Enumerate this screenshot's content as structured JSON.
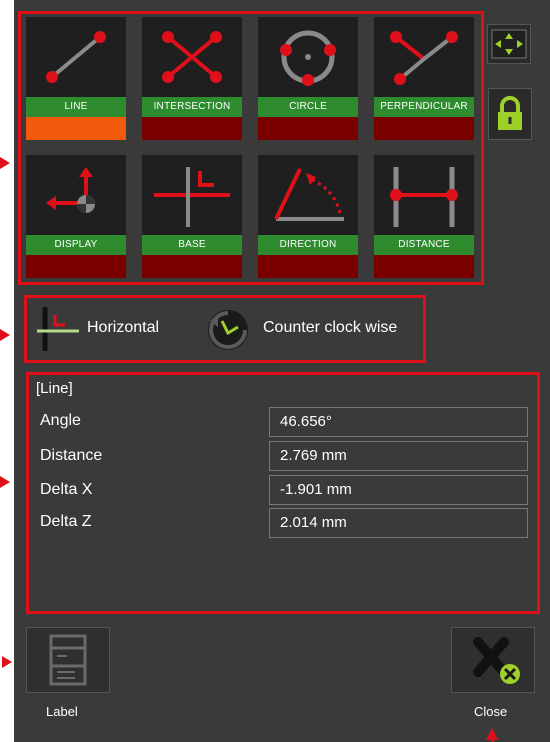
{
  "tools": [
    {
      "label": "LINE",
      "active": true
    },
    {
      "label": "INTERSECTION",
      "active": false
    },
    {
      "label": "CIRCLE",
      "active": false
    },
    {
      "label": "PERPENDICULAR",
      "active": false
    },
    {
      "label": "DISPLAY",
      "active": false
    },
    {
      "label": "BASE",
      "active": false
    },
    {
      "label": "DIRECTION",
      "active": false
    },
    {
      "label": "DISTANCE",
      "active": false
    }
  ],
  "sidebar": {
    "move_icon": "arrows-icon",
    "lock_icon": "lock-icon"
  },
  "modes": {
    "base": "Horizontal",
    "direction": "Counter clock wise"
  },
  "info": {
    "title": "[Line]",
    "rows": [
      {
        "label": "Angle",
        "value": "46.656°"
      },
      {
        "label": "Distance",
        "value": "2.769 mm"
      },
      {
        "label": "Delta X",
        "value": "-1.901 mm"
      },
      {
        "label": "Delta Z",
        "value": "2.014 mm"
      }
    ]
  },
  "buttons": {
    "label": "Label",
    "close": "Close"
  },
  "colors": {
    "highlight": "#e0101a",
    "active": "#f05a0a",
    "tool_green": "#2e8b2e",
    "tool_dark_red": "#7a0000"
  }
}
